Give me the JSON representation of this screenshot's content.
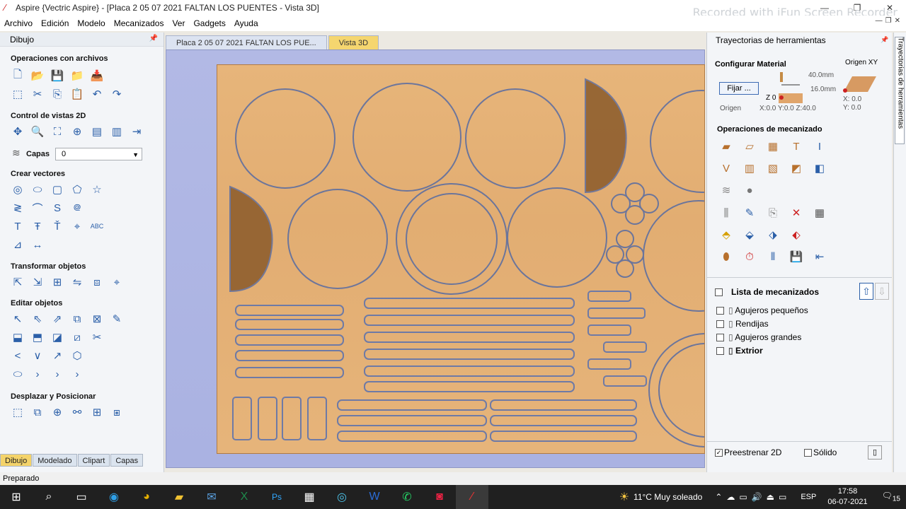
{
  "window": {
    "title": "Aspire {Vectric Aspire} - [Placa 2 05 07 2021 FALTAN LOS PUENTES - Vista 3D]",
    "watermark": "Recorded with iFun Screen Recorder"
  },
  "menu": [
    "Archivo",
    "Edición",
    "Modelo",
    "Mecanizados",
    "Ver",
    "Gadgets",
    "Ayuda"
  ],
  "left_panel": {
    "title": "Dibujo",
    "sections": {
      "archivos": "Operaciones con archivos",
      "vistas": "Control de vistas 2D",
      "capas_label": "Capas",
      "capas_value": "0",
      "crear": "Crear vectores",
      "transformar": "Transformar objetos",
      "editar": "Editar objetos",
      "desplazar": "Desplazar y Posicionar"
    },
    "bottom_tabs": [
      "Dibujo",
      "Modelado",
      "Clipart",
      "Capas"
    ]
  },
  "doc_tabs": [
    "Placa 2 05 07 2021 FALTAN LOS PUE...",
    "Vista 3D"
  ],
  "right_panel": {
    "title": "Trayectorias de herramientas",
    "vertical_tab": "Trayectorias de herramientas",
    "configurar": "Configurar Material",
    "origen_xy": "Origen XY",
    "fijar": "Fijar ...",
    "thickness": "40.0mm",
    "depth": "16.0mm",
    "z0": "Z 0",
    "origen": "Origen",
    "xyz": "X:0.0 Y:0.0 Z:40.0",
    "x": "X: 0.0",
    "y": "Y: 0.0",
    "operaciones": "Operaciones de mecanizado",
    "lista": "Lista de mecanizados",
    "items": [
      "Agujeros pequeños",
      "Rendijas",
      "Agujeros grandes",
      "Extrior"
    ],
    "preestrenar": "Preestrenar 2D",
    "solido": "Sólido"
  },
  "status": "Preparado",
  "taskbar": {
    "weather": "11°C  Muy soleado",
    "lang": "ESP",
    "time": "17:58",
    "date": "06-07-2021",
    "notif": "15"
  }
}
